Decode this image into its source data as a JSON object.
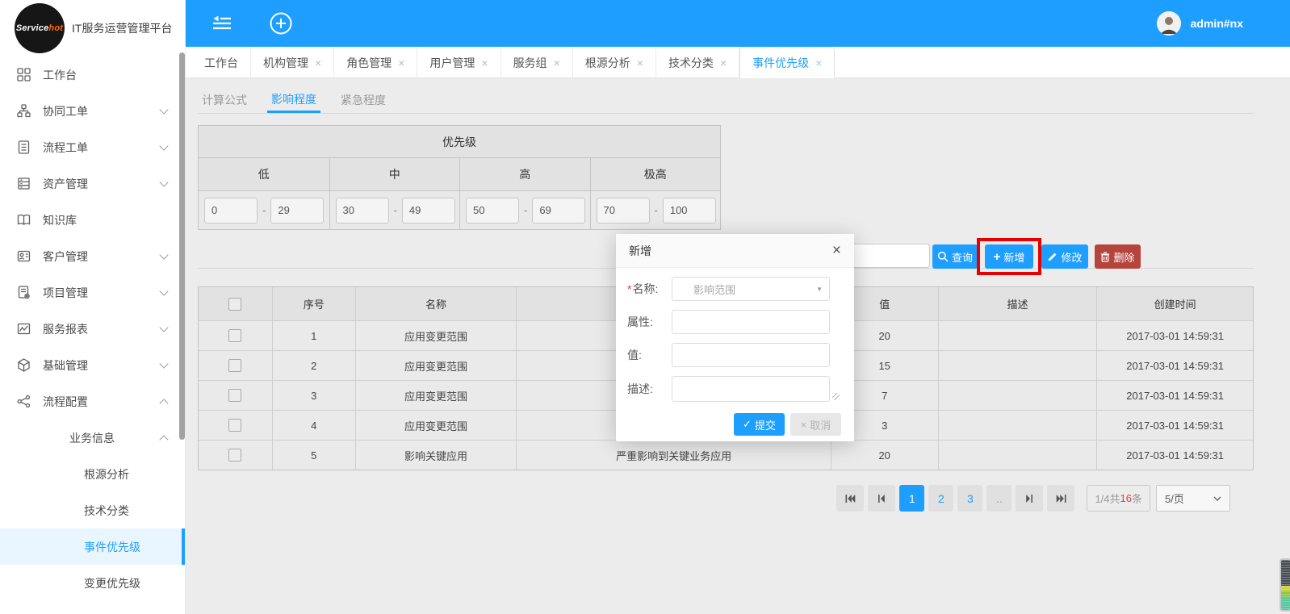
{
  "brand": {
    "logo_text_1": "Service",
    "logo_text_2": "hot",
    "app_title": "IT服务运营管理平台"
  },
  "topbar": {
    "username": "admin#nx"
  },
  "sidebar": {
    "items": [
      {
        "label": "工作台"
      },
      {
        "label": "协同工单"
      },
      {
        "label": "流程工单"
      },
      {
        "label": "资产管理"
      },
      {
        "label": "知识库"
      },
      {
        "label": "客户管理"
      },
      {
        "label": "项目管理"
      },
      {
        "label": "服务报表"
      },
      {
        "label": "基础管理"
      },
      {
        "label": "流程配置"
      },
      {
        "label": "业务信息"
      },
      {
        "label": "根源分析"
      },
      {
        "label": "技术分类"
      },
      {
        "label": "事件优先级"
      },
      {
        "label": "变更优先级"
      }
    ]
  },
  "tabs": {
    "close_glyph": "×",
    "items": [
      {
        "label": "工作台"
      },
      {
        "label": "机构管理"
      },
      {
        "label": "角色管理"
      },
      {
        "label": "用户管理"
      },
      {
        "label": "服务组"
      },
      {
        "label": "根源分析"
      },
      {
        "label": "技术分类"
      },
      {
        "label": "事件优先级"
      }
    ]
  },
  "subtabs": {
    "items": [
      {
        "label": "计算公式"
      },
      {
        "label": "影响程度"
      },
      {
        "label": "紧急程度"
      }
    ]
  },
  "priority_grid": {
    "title": "优先级",
    "separator": "-",
    "levels": [
      {
        "label": "低",
        "min": "0",
        "max": "29"
      },
      {
        "label": "中",
        "min": "30",
        "max": "49"
      },
      {
        "label": "高",
        "min": "50",
        "max": "69"
      },
      {
        "label": "极高",
        "min": "70",
        "max": "100"
      }
    ]
  },
  "toolbar": {
    "search_value": "",
    "query": "查询",
    "add": "新增",
    "edit": "修改",
    "delete": "删除"
  },
  "table": {
    "headers": {
      "seq": "序号",
      "name": "名称",
      "attr": "",
      "value": "值",
      "desc": "描述",
      "created": "创建时间"
    },
    "rows": [
      {
        "seq": "1",
        "name": "应用变更范围",
        "attr": "",
        "value": "20",
        "desc": "",
        "created": "2017-03-01 14:59:31"
      },
      {
        "seq": "2",
        "name": "应用变更范围",
        "attr": "",
        "value": "15",
        "desc": "",
        "created": "2017-03-01 14:59:31"
      },
      {
        "seq": "3",
        "name": "应用变更范围",
        "attr": "",
        "value": "7",
        "desc": "",
        "created": "2017-03-01 14:59:31"
      },
      {
        "seq": "4",
        "name": "应用变更范围",
        "attr": "",
        "value": "3",
        "desc": "",
        "created": "2017-03-01 14:59:31"
      },
      {
        "seq": "5",
        "name": "影响关键应用",
        "attr": "严重影响到关键业务应用",
        "value": "20",
        "desc": "",
        "created": "2017-03-01 14:59:31"
      }
    ]
  },
  "pagination": {
    "pages": [
      "1",
      "2",
      "3",
      ".."
    ],
    "active_page": "1",
    "info_prefix": "1/4共",
    "info_count": "16",
    "info_suffix": "条",
    "page_size": "5/页"
  },
  "modal": {
    "title": "新增",
    "close_glyph": "×",
    "required_mark": "*",
    "name_label": "名称:",
    "name_value": "影响范围",
    "attr_label": "属性:",
    "attr_value": "",
    "value_label": "值:",
    "value_value": "",
    "desc_label": "描述:",
    "desc_value": "",
    "submit": "提交",
    "cancel": "取消"
  }
}
